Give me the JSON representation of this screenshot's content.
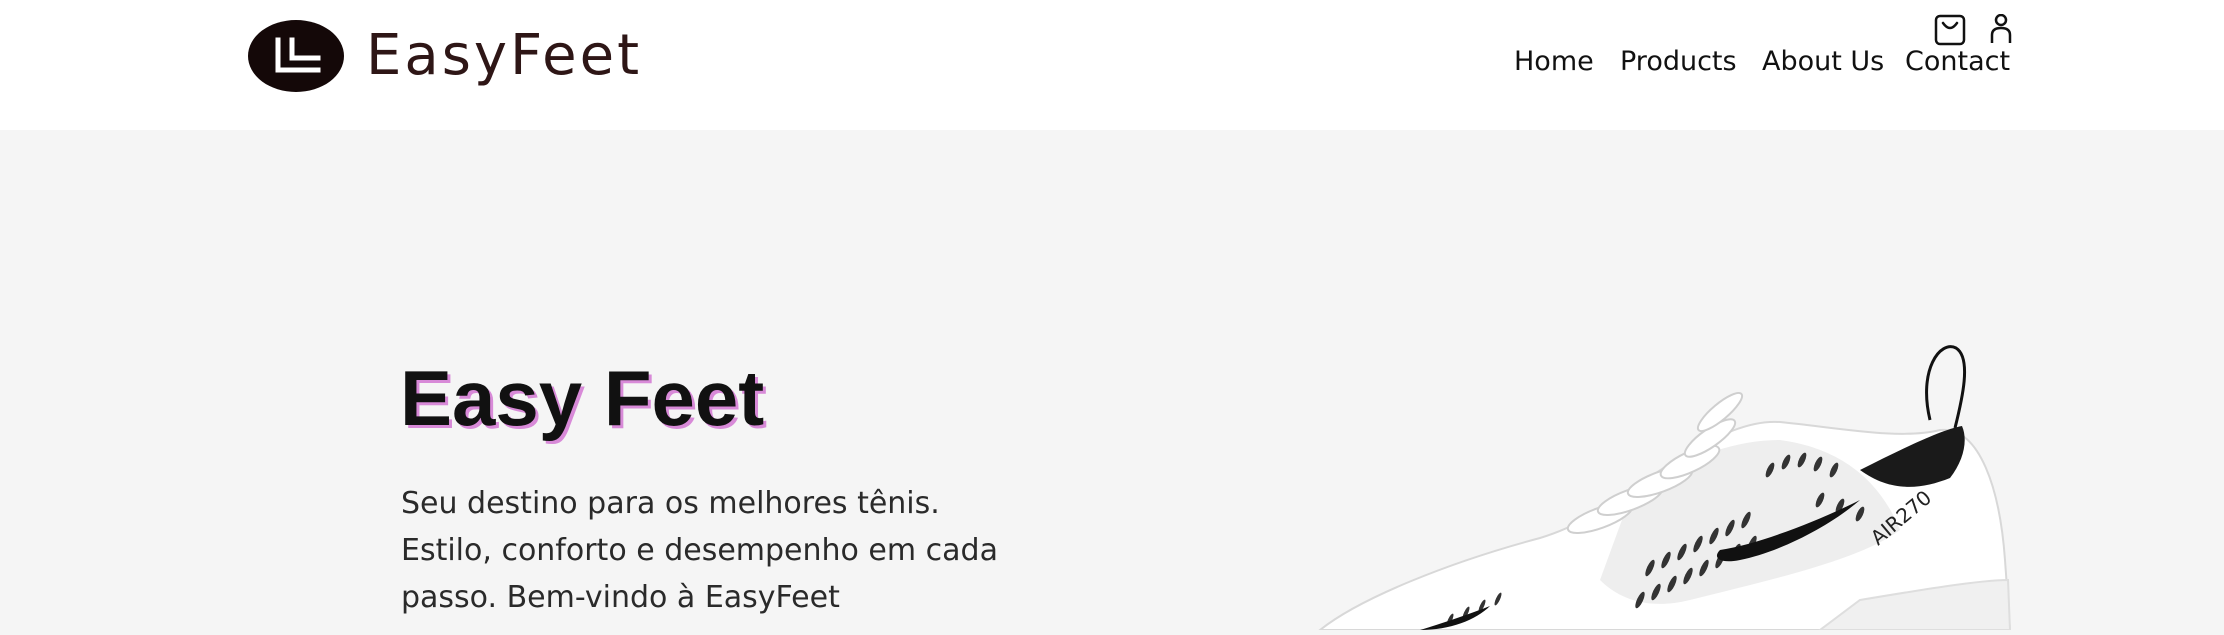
{
  "brand": {
    "name": "EasyFeet"
  },
  "nav": {
    "items": [
      {
        "label": "Home"
      },
      {
        "label": "Products"
      },
      {
        "label": "About Us"
      },
      {
        "label": "Contact"
      }
    ],
    "icons": {
      "cart": "shopping-bag-icon",
      "account": "user-icon"
    }
  },
  "hero": {
    "title": "Easy Feet",
    "description": "Seu destino para os melhores tênis. Estilo, conforto e desempenho em cada passo. Bem-vindo à EasyFeet",
    "image": {
      "alt": "white-sneaker-image",
      "model_text": "AIR270"
    }
  },
  "colors": {
    "header_bg": "#ffffff",
    "page_bg": "#f5f5f5",
    "logo_mark": "#140808",
    "logo_text": "#2e1616",
    "title_shadow": "#d88ad8"
  }
}
